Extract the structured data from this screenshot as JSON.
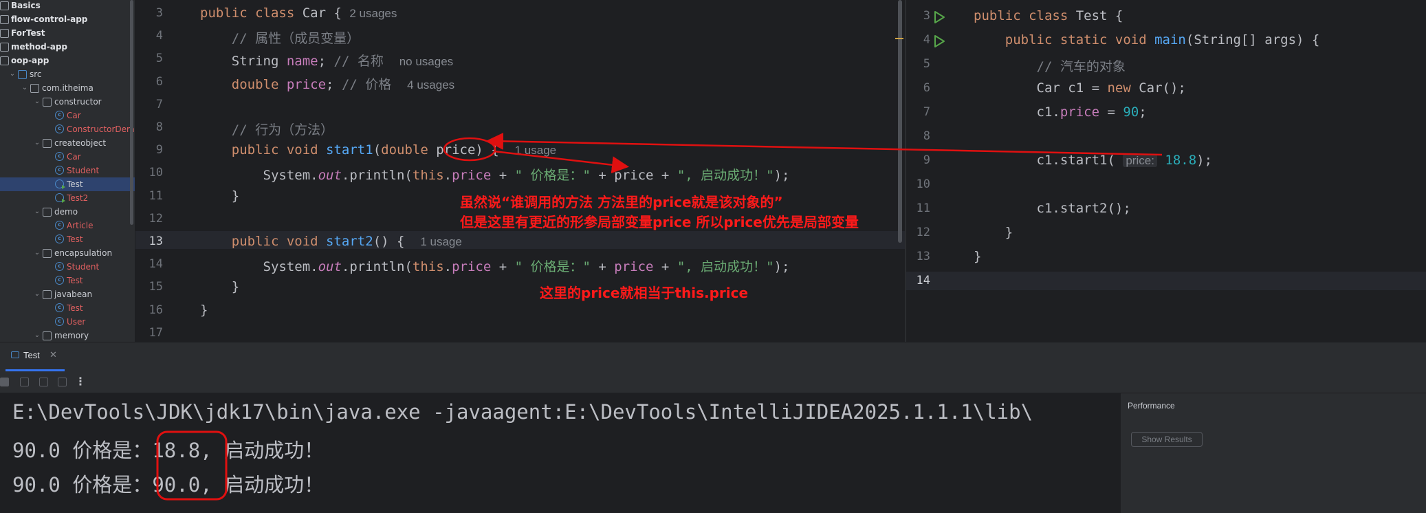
{
  "sidebar": {
    "items": [
      {
        "label": "Basics",
        "type": "module"
      },
      {
        "label": "flow-control-app",
        "type": "module"
      },
      {
        "label": "ForTest",
        "type": "module"
      },
      {
        "label": "method-app",
        "type": "module"
      },
      {
        "label": "oop-app",
        "type": "module"
      },
      {
        "label": "src",
        "type": "source-folder"
      },
      {
        "label": "com.itheima",
        "type": "package"
      },
      {
        "label": "constructor",
        "type": "package"
      },
      {
        "label": "Car",
        "type": "class"
      },
      {
        "label": "ConstructorDemo",
        "type": "class"
      },
      {
        "label": "createobject",
        "type": "package"
      },
      {
        "label": "Car",
        "type": "class"
      },
      {
        "label": "Student",
        "type": "class"
      },
      {
        "label": "Test",
        "type": "runnable-class",
        "selected": true
      },
      {
        "label": "Test2",
        "type": "runnable-class"
      },
      {
        "label": "demo",
        "type": "package"
      },
      {
        "label": "Article",
        "type": "class"
      },
      {
        "label": "Test",
        "type": "class"
      },
      {
        "label": "encapsulation",
        "type": "package"
      },
      {
        "label": "Student",
        "type": "class"
      },
      {
        "label": "Test",
        "type": "class"
      },
      {
        "label": "javabean",
        "type": "package"
      },
      {
        "label": "Test",
        "type": "class"
      },
      {
        "label": "User",
        "type": "class"
      },
      {
        "label": "memory",
        "type": "package"
      }
    ]
  },
  "editor_left": {
    "lines": [
      {
        "num": "3",
        "usages": "2 usages"
      },
      {
        "num": "4",
        "comment": "// 属性（成员变量）"
      },
      {
        "num": "5",
        "comment": "// 名称",
        "usages": "no usages"
      },
      {
        "num": "6",
        "comment": "// 价格",
        "usages": "4 usages"
      },
      {
        "num": "7"
      },
      {
        "num": "8",
        "comment": "// 行为（方法）"
      },
      {
        "num": "9",
        "usages": "1 usage"
      },
      {
        "num": "10",
        "str1": "\" 价格是：\"",
        "str2": "\", 启动成功！\""
      },
      {
        "num": "11"
      },
      {
        "num": "12"
      },
      {
        "num": "13",
        "usages": "1 usage"
      },
      {
        "num": "14",
        "str1": "\" 价格是：\"",
        "str2": "\", 启动成功！\""
      },
      {
        "num": "15"
      },
      {
        "num": "16"
      },
      {
        "num": "17"
      }
    ]
  },
  "editor_right": {
    "lines": [
      {
        "num": "3"
      },
      {
        "num": "4"
      },
      {
        "num": "5",
        "comment": "// 汽车的对象"
      },
      {
        "num": "6"
      },
      {
        "num": "7",
        "value": "90"
      },
      {
        "num": "8"
      },
      {
        "num": "9",
        "inlay": "price:",
        "value": "18.8"
      },
      {
        "num": "10"
      },
      {
        "num": "11"
      },
      {
        "num": "12"
      },
      {
        "num": "13"
      },
      {
        "num": "14"
      }
    ]
  },
  "bottom": {
    "run_tab": "Test",
    "console_lines": [
      "E:\\DevTools\\JDK\\jdk17\\bin\\java.exe -javaagent:E:\\DevTools\\IntelliJIDEA2025.1.1.1\\lib\\",
      {
        "prefix": "90.0 价格是：",
        "value": "18.8",
        "suffix": ", 启动成功！"
      },
      {
        "prefix": "90.0 价格是：",
        "value": "90.0",
        "suffix": ", 启动成功！"
      }
    ],
    "performance_title": "Performance",
    "show_results_label": "Show Results"
  },
  "annotations": {
    "note1": "虽然说“谁调用的方法 方法里的price就是该对象的”",
    "note2": "但是这里有更近的形参局部变量price 所以price优先是局部变量",
    "note3": "这里的price就相当于this.price"
  },
  "colors": {
    "annotation": "#ff1a1a",
    "keyword": "#cf8e6d",
    "field": "#c77dbb",
    "string": "#6aab73",
    "number": "#2aacb8",
    "function": "#56a8f5"
  }
}
